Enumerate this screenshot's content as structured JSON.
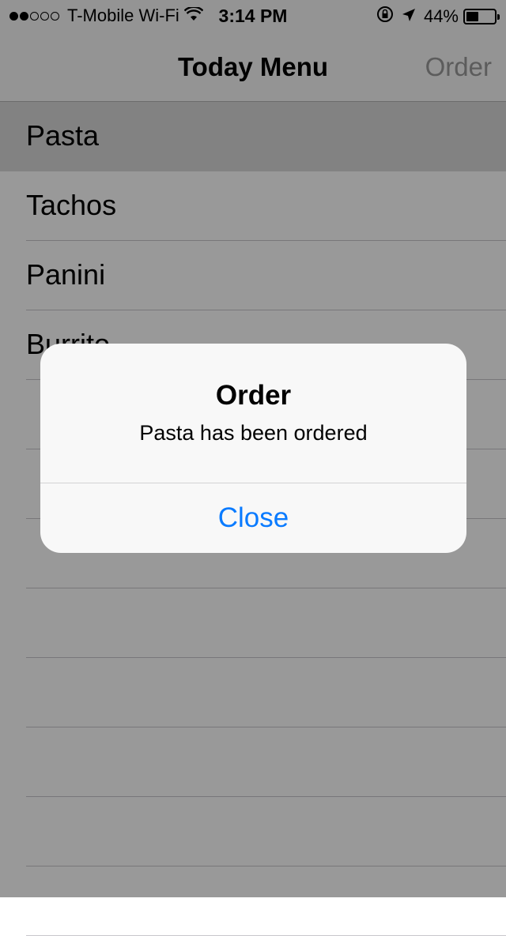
{
  "status_bar": {
    "carrier": "T-Mobile Wi-Fi",
    "time": "3:14 PM",
    "battery_percent": "44%",
    "battery_level": 0.44,
    "signal_dots_filled": 2,
    "signal_dots_total": 5,
    "icons": [
      "wifi-icon",
      "rotation-lock-icon",
      "location-arrow-icon",
      "battery-icon"
    ]
  },
  "nav": {
    "title": "Today Menu",
    "right_button": "Order"
  },
  "menu": {
    "items": [
      {
        "label": "Pasta",
        "selected": true
      },
      {
        "label": "Tachos",
        "selected": false
      },
      {
        "label": "Panini",
        "selected": false
      },
      {
        "label": "Burrito",
        "selected": false
      }
    ],
    "empty_rows": 8
  },
  "alert": {
    "title": "Order",
    "message": "Pasta has been ordered",
    "button": "Close"
  },
  "colors": {
    "accent": "#0a7bff",
    "nav_button_disabled": "#9a9a9a",
    "overlay": "rgba(0,0,0,0.4)"
  }
}
